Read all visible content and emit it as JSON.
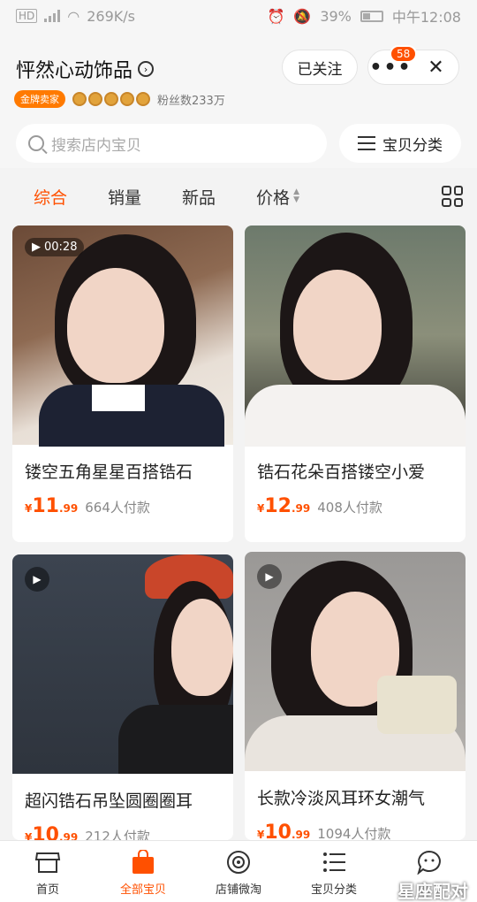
{
  "status_bar": {
    "carrier": "HD",
    "network_speed": "269K/s",
    "battery": "39%",
    "time": "中午12:08"
  },
  "header": {
    "shop_name": "怦然心动饰品",
    "seller_badge": "金牌卖家",
    "fans": "粉丝数233万",
    "follow_label": "已关注",
    "notification_count": "58"
  },
  "search": {
    "placeholder": "搜索店内宝贝",
    "category_label": "宝贝分类"
  },
  "tabs": [
    {
      "label": "综合",
      "active": true
    },
    {
      "label": "销量"
    },
    {
      "label": "新品"
    },
    {
      "label": "价格"
    }
  ],
  "products": [
    {
      "title": "镂空五角星星百搭锆石",
      "currency": "¥",
      "price_int": "11",
      "price_dec": ".99",
      "paid": "664人付款",
      "video_duration": "00:28"
    },
    {
      "title": "锆石花朵百搭镂空小爱",
      "currency": "¥",
      "price_int": "12",
      "price_dec": ".99",
      "paid": "408人付款"
    },
    {
      "title": "超闪锆石吊坠圆圈圈耳",
      "currency": "¥",
      "price_int": "10",
      "price_dec": ".99",
      "paid": "212人付款"
    },
    {
      "title": "长款冷淡风耳环女潮气",
      "currency": "¥",
      "price_int": "10",
      "price_dec": ".99",
      "paid": "1094人付款"
    }
  ],
  "bottom_nav": [
    {
      "label": "首页",
      "icon": "shop-icon"
    },
    {
      "label": "全部宝贝",
      "icon": "bag-icon",
      "active": true
    },
    {
      "label": "店铺微淘",
      "icon": "broadcast-icon"
    },
    {
      "label": "宝贝分类",
      "icon": "list-icon"
    },
    {
      "label": "",
      "icon": "chat-icon"
    }
  ],
  "watermark": "星座配对",
  "colors": {
    "accent": "#ff5000",
    "badge": "#ff7a00"
  }
}
